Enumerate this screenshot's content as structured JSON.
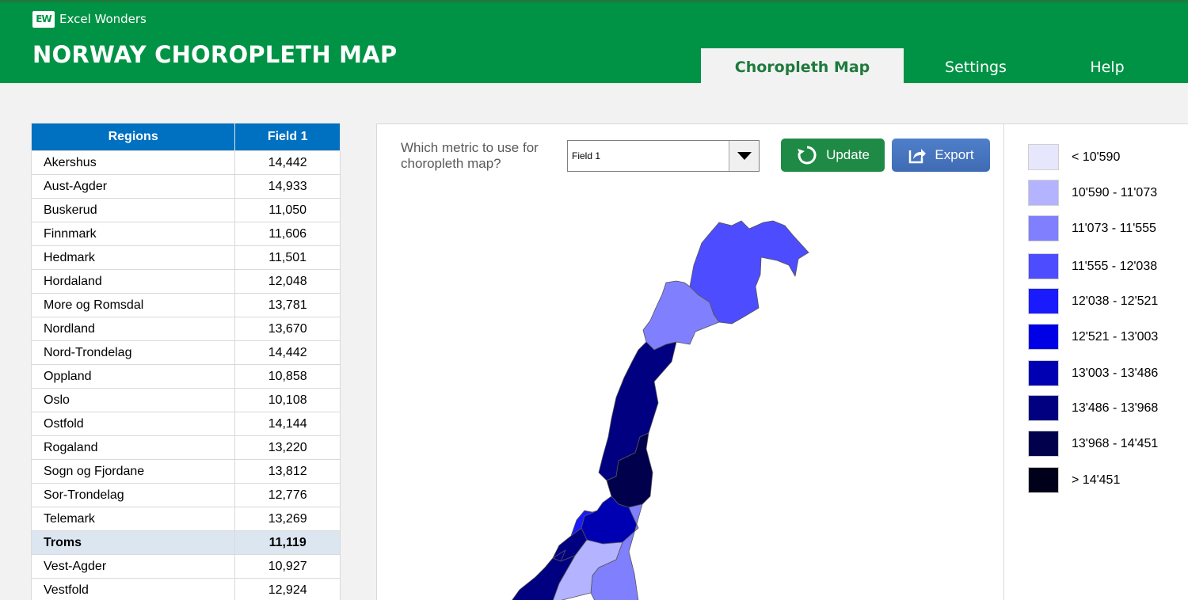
{
  "header": {
    "brand_logo": "EW",
    "brand_name": "Excel Wonders",
    "title": "NORWAY CHOROPLETH MAP",
    "tabs": [
      {
        "label": "Choropleth Map",
        "active": true
      },
      {
        "label": "Settings",
        "active": false
      },
      {
        "label": "Help",
        "active": false
      }
    ]
  },
  "table": {
    "headers": [
      "Regions",
      "Field 1"
    ],
    "rows": [
      {
        "region": "Akershus",
        "value": "14,442"
      },
      {
        "region": "Aust-Agder",
        "value": "14,933"
      },
      {
        "region": "Buskerud",
        "value": "11,050"
      },
      {
        "region": "Finnmark",
        "value": "11,606"
      },
      {
        "region": "Hedmark",
        "value": "11,501"
      },
      {
        "region": "Hordaland",
        "value": "12,048"
      },
      {
        "region": "More og Romsdal",
        "value": "13,781"
      },
      {
        "region": "Nordland",
        "value": "13,670"
      },
      {
        "region": "Nord-Trondelag",
        "value": "14,442"
      },
      {
        "region": "Oppland",
        "value": "10,858"
      },
      {
        "region": "Oslo",
        "value": "10,108"
      },
      {
        "region": "Ostfold",
        "value": "14,144"
      },
      {
        "region": "Rogaland",
        "value": "13,220"
      },
      {
        "region": "Sogn og Fjordane",
        "value": "13,812"
      },
      {
        "region": "Sor-Trondelag",
        "value": "12,776"
      },
      {
        "region": "Telemark",
        "value": "13,269"
      },
      {
        "region": "Troms",
        "value": "11,119",
        "selected": true
      },
      {
        "region": "Vest-Agder",
        "value": "10,927"
      },
      {
        "region": "Vestfold",
        "value": "12,924"
      }
    ]
  },
  "controls": {
    "metric_label": "Which metric to use for choropleth map?",
    "metric_value": "Field 1",
    "update_label": "Update",
    "export_label": "Export"
  },
  "legend": [
    {
      "label": "< 10'590",
      "color": "#e6e6fc"
    },
    {
      "label": "10'590 - 11'073",
      "color": "#b3b3ff"
    },
    {
      "label": "11'073 - 11'555",
      "color": "#8080ff"
    },
    {
      "label": "11'555 - 12'038",
      "color": "#4d4dff"
    },
    {
      "label": "12'038 - 12'521",
      "color": "#1a1aff"
    },
    {
      "label": "12'521 - 13'003",
      "color": "#0000e6"
    },
    {
      "label": "13'003 - 13'486",
      "color": "#0000b3"
    },
    {
      "label": "13'486 - 13'968",
      "color": "#000080"
    },
    {
      "label": "13'968 - 14'451",
      "color": "#00004d"
    },
    {
      "label": "> 14'451",
      "color": "#00001a"
    }
  ],
  "map_colors": {
    "finnmark": "#4d4dff",
    "troms": "#8080ff",
    "nordland": "#000080",
    "nord_trondelag": "#00004d",
    "sor_trondelag": "#0000b3",
    "more_og_romsdal": "#000080",
    "hedmark": "#8080ff",
    "oppland": "#b3b3ff",
    "sogn_og_fjordane": "#000080",
    "hordaland": "#1a1aff",
    "west_coast": "#000080"
  }
}
